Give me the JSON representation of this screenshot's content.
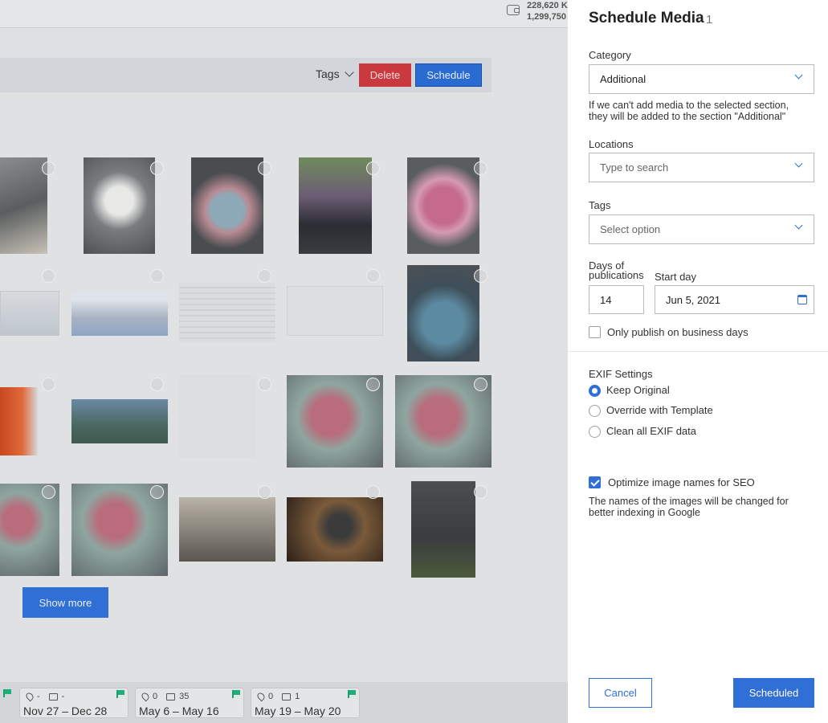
{
  "header": {
    "balance_line1": "228,620 K",
    "balance_line2": "1,299,750"
  },
  "toolbar": {
    "tags_label": "Tags",
    "delete_label": "Delete",
    "schedule_label": "Schedule"
  },
  "gallery": {
    "show_more_label": "Show more"
  },
  "timeline": {
    "cards": [
      {
        "locations": "-",
        "images": "-",
        "dates": "Nov 27 – Dec 28"
      },
      {
        "locations": "0",
        "images": "35",
        "dates": "May 6 – May 16"
      },
      {
        "locations": "0",
        "images": "1",
        "dates": "May 19 – May 20"
      }
    ]
  },
  "panel": {
    "title": "Schedule Media",
    "count": "1",
    "category": {
      "label": "Category",
      "value": "Additional",
      "help": "If we can't add media to the selected section, they will be added to the section \"Additional\""
    },
    "locations": {
      "label": "Locations",
      "placeholder": "Type to search"
    },
    "tags": {
      "label": "Tags",
      "placeholder": "Select option"
    },
    "days": {
      "label_line1": "Days of",
      "label_line2": "publications",
      "value": "14"
    },
    "start": {
      "label": "Start day",
      "value": "Jun 5, 2021"
    },
    "business_days": {
      "label": "Only publish on business days",
      "checked": false
    },
    "exif": {
      "label": "EXIF Settings",
      "options": [
        "Keep Original",
        "Override with Template",
        "Clean all EXIF data"
      ],
      "selected": "Keep Original"
    },
    "seo": {
      "label": "Optimize image names for SEO",
      "checked": true,
      "help": "The names of the images will be changed for better indexing in Google"
    },
    "cancel_label": "Cancel",
    "submit_label": "Scheduled"
  },
  "colors": {
    "accent": "#2f6fd6",
    "danger": "#c9393d",
    "flag": "#1bb07a"
  }
}
